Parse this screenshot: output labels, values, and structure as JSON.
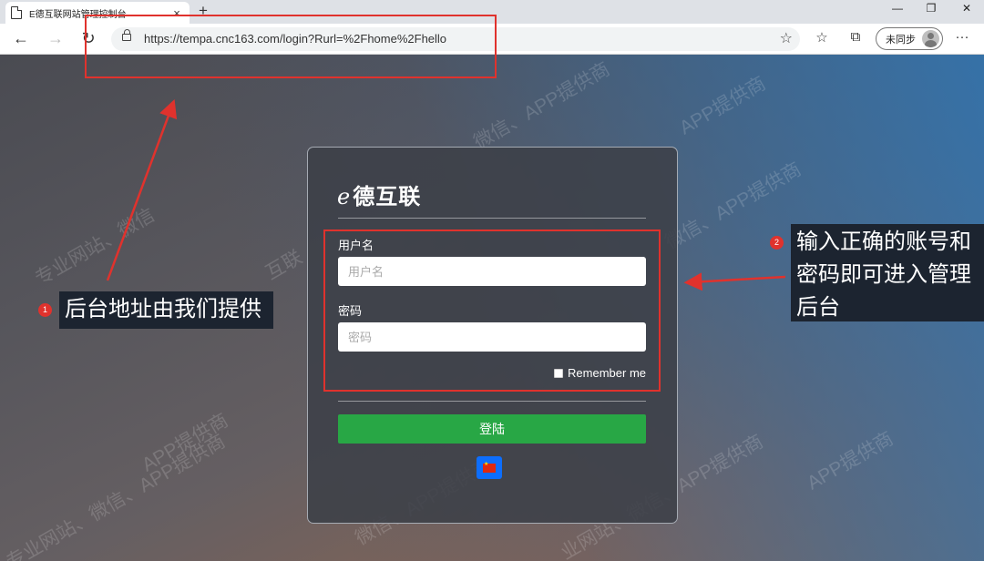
{
  "browser": {
    "tab_title": "E德互联网站管理控制台",
    "tab_close": "×",
    "new_tab": "+",
    "window_controls": {
      "minimize": "—",
      "restore": "❐",
      "close": "✕"
    },
    "back": "←",
    "forward": "→",
    "refresh": "↻",
    "url": "https://tempa.cnc163.com/login?Rurl=%2Fhome%2Fhello",
    "favorite": "☆",
    "favorites_bar": "☆",
    "collections": "⧉",
    "profile_label": "未同步",
    "more": "···"
  },
  "login": {
    "logo_mark": "e",
    "logo_text": "德互联",
    "username_label": "用户名",
    "username_placeholder": "用户名",
    "username_value": "",
    "password_label": "密码",
    "password_placeholder": "密码",
    "password_value": "",
    "remember_label": "Remember me",
    "remember_checked": false,
    "submit_label": "登陆"
  },
  "annotations": {
    "note1_number": "1",
    "note1_text": "后台地址由我们提供",
    "note2_number": "2",
    "note2_line1": "输入正确的账号和",
    "note2_line2": "密码即可进入管理",
    "note2_line3": "后台",
    "color": "#e0322d"
  },
  "watermarks": [
    {
      "text": "APP提供商"
    },
    {
      "text": "微信、APP提供商"
    },
    {
      "text": "专业网站、微信"
    },
    {
      "text": "互联"
    },
    {
      "text": "APP提供商"
    },
    {
      "text": "微信、APP提供商"
    },
    {
      "text": "专业网站、微信、APP提供商"
    },
    {
      "text": "业网站、微信、APP提供商"
    },
    {
      "text": "APP提供商"
    },
    {
      "text": "微信、APP提供商"
    }
  ]
}
